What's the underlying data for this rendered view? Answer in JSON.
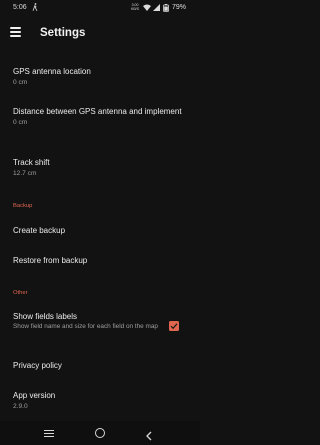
{
  "status_bar": {
    "time": "5:06",
    "network_speed": "3.00",
    "network_unit": "KB/S",
    "battery": "79%"
  },
  "app_bar": {
    "title": "Settings"
  },
  "settings": {
    "gps_antenna_location": {
      "title": "GPS antenna location",
      "value": "0 cm"
    },
    "distance_gps_implement": {
      "title": "Distance between GPS antenna and implement",
      "value": "0 cm"
    },
    "track_shift": {
      "title": "Track shift",
      "value": "12.7 cm"
    },
    "backup_section": "Backup",
    "create_backup": {
      "title": "Create backup"
    },
    "restore_backup": {
      "title": "Restore from backup"
    },
    "other_section": "Other",
    "show_fields_labels": {
      "title": "Show fields labels",
      "description": "Show field name and size for each field on the map",
      "checked": true
    },
    "privacy_policy": {
      "title": "Privacy policy"
    },
    "app_version": {
      "title": "App version",
      "value": "2.9.0"
    }
  },
  "colors": {
    "background": "#121212",
    "accent": "#e0664f"
  },
  "icons": {
    "menu": "hamburger-menu-icon",
    "checkbox": "checkmark-icon",
    "nav_recents": "recents-icon",
    "nav_home": "home-icon",
    "nav_back": "back-icon"
  }
}
